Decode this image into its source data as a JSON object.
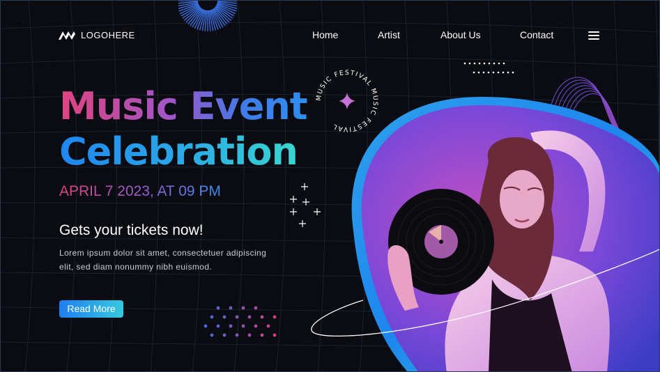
{
  "header": {
    "logo_text": "LOGOHERE",
    "nav": {
      "home": "Home",
      "artist": "Artist",
      "about": "About Us",
      "contact": "Contact"
    },
    "menu_icon": "hamburger-menu-icon"
  },
  "hero": {
    "title_line1": "Music Event",
    "title_line2": "Celebration",
    "date": "APRIL 7 2023, AT 09 PM",
    "tagline": "Gets your tickets now!",
    "description": "Lorem ipsum dolor sit amet, consectetuer adipiscing elit, sed diam nonummy nibh euismod.",
    "cta_label": "Read More"
  },
  "badge": {
    "text": "MUSIC FESTIVAL MUSIC FESTIVAL"
  },
  "colors": {
    "background": "#0a0c11",
    "pink": "#e0437f",
    "purple": "#a155c8",
    "blue": "#1f86ee",
    "teal": "#39d6d1"
  }
}
